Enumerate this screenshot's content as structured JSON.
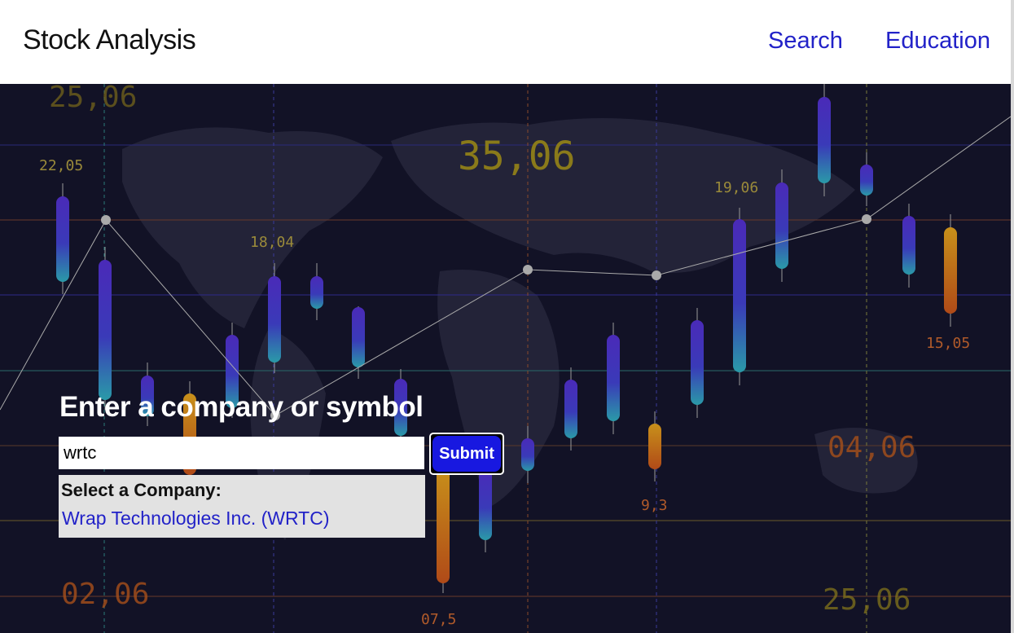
{
  "header": {
    "brand": "Stock Analysis",
    "nav": [
      {
        "label": "Search"
      },
      {
        "label": "Education"
      }
    ]
  },
  "search": {
    "heading": "Enter a company or symbol",
    "input_value": "wrtc",
    "submit_label": "Submit"
  },
  "results": {
    "title": "Select a Company:",
    "items": [
      {
        "label": "Wrap Technologies Inc. (WRTC)"
      }
    ]
  },
  "background": {
    "labels": [
      "25,06",
      "22,05",
      "35,06",
      "18,04",
      "19,06",
      "15,05",
      "04,06",
      "9,3",
      "02,06",
      "07,5",
      "25,06"
    ]
  },
  "colors": {
    "link": "#2222c8",
    "submit": "#1818e0",
    "background": "#121226"
  }
}
